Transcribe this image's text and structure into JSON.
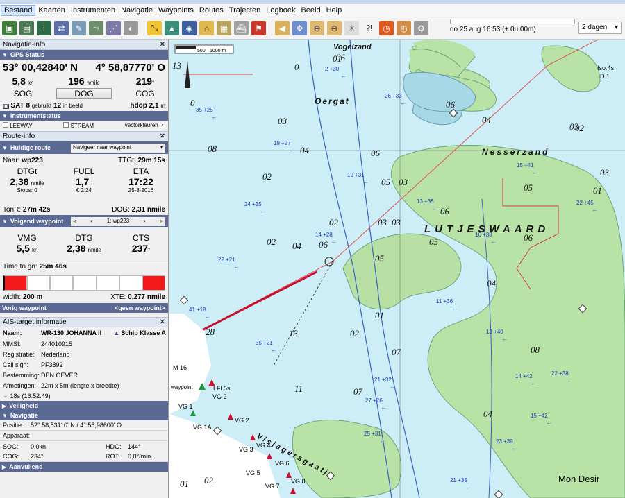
{
  "menu": [
    "Bestand",
    "Kaarten",
    "Instrumenten",
    "Navigatie",
    "Waypoints",
    "Routes",
    "Trajecten",
    "Logboek",
    "Beeld",
    "Help"
  ],
  "toolbar": {
    "timeline_text": "do 25 aug 16:53  (+ 0u 00m)",
    "days_select": "2 dagen"
  },
  "nav": {
    "title": "Navigatie-info",
    "gps_head": "GPS Status",
    "lat": "53° 00,42840' N",
    "lon": "4° 58,87770' O",
    "sog_value": "5,8",
    "sog_unit": "kn",
    "sog_label": "SOG",
    "dist_value": "196",
    "dist_unit": "nmile",
    "dog_button": "DOG",
    "cog_value": "219",
    "cog_unit": "°",
    "cog_label": "COG",
    "sat_text": "SAT 8",
    "sat_used": "gebruikt",
    "sat_count": "12",
    "sat_view": "in beeld",
    "hdop_label": "hdop",
    "hdop_value": "2,1",
    "hdop_unit": "m",
    "instr_head": "Instrumentstatus",
    "leeway": "LEEWAY",
    "stream": "STREAM",
    "vectorcolors": "vectorkleuren"
  },
  "route": {
    "title": "Route-info",
    "current_route_head": "Huidige route",
    "current_route_select": "Navigeer naar waypoint",
    "to_label": "Naar:",
    "to_value": "wp223",
    "ttgt_label": "TTGt:",
    "ttgt_value": "29m 15s",
    "dtgt_label": "DTGt",
    "dtgt_value": "2,38",
    "dtgt_unit": "nmile",
    "stops_label": "Stops:",
    "stops_value": "0",
    "fuel_label": "FUEL",
    "fuel_value": "1,7",
    "fuel_unit": "l",
    "fuel_cost": "€ 2,24",
    "eta_label": "ETA",
    "eta_value": "17:22",
    "eta_date": "25-8-2016",
    "tonr_label": "TonR:",
    "tonr_value": "27m 42s",
    "dog_label": "DOG:",
    "dog_value": "2,31 nmile",
    "next_wp_head": "Volgend waypoint",
    "next_wp_select": "1: wp223",
    "vmg_label": "VMG",
    "vmg_value": "5,5",
    "vmg_unit": "kn",
    "dtg_label": "DTG",
    "dtg_value": "2,38",
    "dtg_unit": "nmile",
    "cts_label": "CTS",
    "cts_value": "237",
    "cts_unit": "°",
    "ttg_label": "Time to go:",
    "ttg_value": "25m 46s",
    "width_label": "width:",
    "width_value": "200 m",
    "xte_label": "XTE:",
    "xte_value": "0,277 nmile",
    "prev_wp_head": "Vorig waypoint",
    "prev_wp_value": "<geen waypoint>"
  },
  "ais": {
    "title": "AIS-target informatie",
    "name_label": "Naam:",
    "name_value": "WR-130 JOHANNA II",
    "class_value": "Schip Klasse A",
    "rows": [
      {
        "k": "MMSI:",
        "v": "244010915"
      },
      {
        "k": "Registratie:",
        "v": "Nederland"
      },
      {
        "k": "Call sign:",
        "v": "PF3892"
      },
      {
        "k": "Bestemming:",
        "v": "DEN OEVER"
      },
      {
        "k": "Afmetingen:",
        "v": "22m x 5m (lengte x breedte)"
      }
    ],
    "age": "18s (16:52:49)",
    "safety_head": "Veiligheid",
    "nav_head": "Navigatie",
    "position_label": "Positie:",
    "position_value": "52° 58,53110' N / 4° 55,98600' O",
    "device_label": "Apparaat:",
    "sog_label": "SOG:",
    "sog_value": "0,0kn",
    "hdg_label": "HDG:",
    "hdg_value": "144°",
    "cog_label": "COG:",
    "cog_value": "234°",
    "rot_label": "ROT:",
    "rot_value": "0,0°/min.",
    "extra_head": "Aanvullend"
  },
  "map": {
    "scale_500": "500",
    "scale_1000": "1000 m",
    "places": {
      "vogelzand": "Vogelzand",
      "oergat": "Oergat",
      "nesserzand": "Nesserzand",
      "lutjeswaard": "LUTJESWAARD",
      "visjagersgaatje": "Visjagersgaatje",
      "mon_desir": "Mon Desir"
    },
    "labels": {
      "m16": "M 16",
      "iso4s": "Iso.4s",
      "d1": "D 1",
      "lfl5s": "LFl.5s",
      "vg1": "VG 1",
      "vg2": "VG 2",
      "vg3": "VG 3",
      "vg4": "VG 4",
      "vg5": "VG 5",
      "vg6": "VG 6",
      "vg7": "VG 7",
      "vg8": "VG 8",
      "vg1a": "VG 1A",
      "wplabel": "waypoint"
    },
    "depths": [
      "13",
      "0",
      "0",
      "06",
      "03",
      "08",
      "04",
      "06",
      "02",
      "05",
      "03",
      "03",
      "05",
      "02",
      "06",
      "06",
      "05",
      "03",
      "06",
      "03",
      "04",
      "01",
      "02",
      "07",
      "08",
      "01",
      "02",
      "04",
      "02",
      "01",
      "03",
      "04",
      "06",
      "07",
      "11",
      "13",
      "28",
      "05",
      "04",
      "01",
      "02"
    ],
    "currents": [
      "2 +30",
      "19 +27",
      "19 +31",
      "35 +25",
      "24 +25",
      "14 +28",
      "13 +35",
      "16 +38",
      "11 +36",
      "13 +40",
      "15 +41",
      "22 +45",
      "14 +42",
      "15 +42",
      "22 +38",
      "23 +39",
      "25 +31",
      "21 +32",
      "35 +21",
      "41 +18",
      "22 +21",
      "26 +33",
      "27 +26",
      "21 +35"
    ]
  }
}
